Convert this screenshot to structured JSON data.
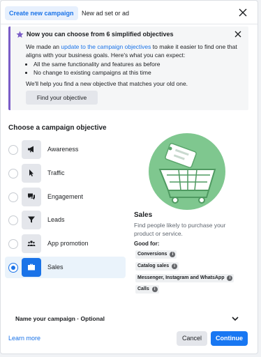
{
  "tabs": [
    {
      "label": "Create new campaign",
      "active": true
    },
    {
      "label": "New ad set or ad",
      "active": false
    }
  ],
  "notice": {
    "title": "Now you can choose from 6 simplified objectives",
    "body_prefix": "We made an ",
    "body_link": "update to the campaign objectives",
    "body_suffix": " to make it easier to find one that aligns with your business goals. Here's what you can expect:",
    "bullets": [
      "All the same functionality and features as before",
      "No change to existing campaigns at this time"
    ],
    "help_text": "We'll help you find a new objective that matches your old one.",
    "button_label": "Find your objective"
  },
  "section_title": "Choose a campaign objective",
  "objectives": [
    {
      "label": "Awareness",
      "icon": "megaphone-icon",
      "selected": false
    },
    {
      "label": "Traffic",
      "icon": "cursor-icon",
      "selected": false
    },
    {
      "label": "Engagement",
      "icon": "chat-bubbles-icon",
      "selected": false
    },
    {
      "label": "Leads",
      "icon": "funnel-icon",
      "selected": false
    },
    {
      "label": "App promotion",
      "icon": "people-icon",
      "selected": false
    },
    {
      "label": "Sales",
      "icon": "briefcase-icon",
      "selected": true
    }
  ],
  "detail": {
    "title": "Sales",
    "description": "Find people likely to purchase your product or service.",
    "good_for_label": "Good for:",
    "chips": [
      "Conversions",
      "Catalog sales",
      "Messenger, Instagram and WhatsApp",
      "Calls"
    ]
  },
  "name_campaign_label": "Name your campaign · Optional",
  "footer": {
    "learn_more": "Learn more",
    "cancel": "Cancel",
    "continue": "Continue"
  },
  "colors": {
    "accent": "#1877f2",
    "link": "#1a73e8",
    "notice_border": "#7a5cc7",
    "illustration_green": "#7fc78f"
  }
}
